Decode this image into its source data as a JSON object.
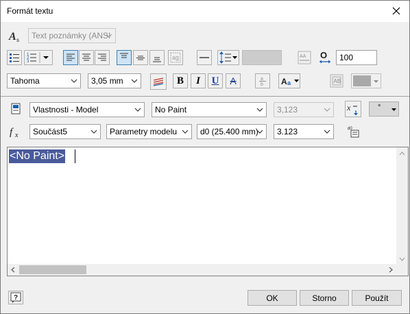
{
  "window": {
    "title": "Formát textu"
  },
  "row1": {
    "style_combo": "Text poznámky (ANSI"
  },
  "row2": {
    "width_value": "100"
  },
  "row3": {
    "font": "Tahoma",
    "size": "3,05 mm",
    "bold": "B",
    "italic": "I",
    "underline": "U",
    "strike": "A"
  },
  "row4": {
    "property_source": "Vlastnosti - Model",
    "property": "No Paint",
    "precision": "3,123",
    "symbol": "°"
  },
  "row5": {
    "fx": "fx",
    "component": "Součást5",
    "param_type": "Parametry modelu",
    "parameter": "d0 (25.400 mm)",
    "param_precision": "3.123"
  },
  "editor": {
    "content": "<No Paint>"
  },
  "footer": {
    "ok": "OK",
    "cancel": "Storno",
    "apply": "Použít"
  },
  "colors": {
    "accent": "#3c7fb1",
    "selection": "#4a5a9b",
    "dialog_bg": "#f0f0f0"
  }
}
